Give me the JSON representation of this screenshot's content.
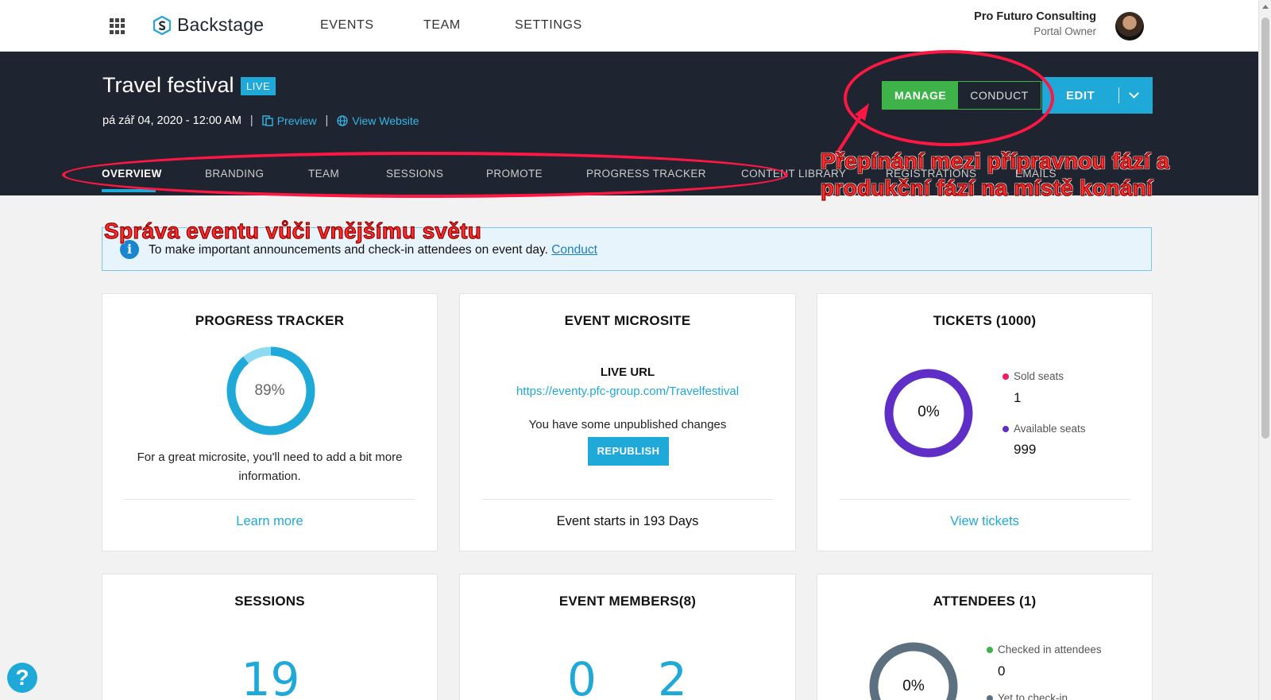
{
  "app": {
    "name": "Backstage"
  },
  "topnav": {
    "events": "EVENTS",
    "team": "TEAM",
    "settings": "SETTINGS"
  },
  "user": {
    "name": "Pro Futuro Consulting",
    "role": "Portal Owner"
  },
  "event": {
    "title": "Travel festival",
    "badge": "LIVE",
    "datetime": "pá zář 04, 2020 - 12:00 AM",
    "preview": "Preview",
    "view_website": "View Website"
  },
  "actions": {
    "manage": "MANAGE",
    "conduct": "CONDUCT",
    "edit": "EDIT"
  },
  "tabs": [
    "OVERVIEW",
    "BRANDING",
    "TEAM",
    "SESSIONS",
    "PROMOTE",
    "PROGRESS TRACKER",
    "CONTENT LIBRARY",
    "REGISTRATIONS",
    "EMAILS"
  ],
  "annotations": {
    "mode_switch": [
      "Přepínání mezi přípravnou fází a",
      "produkční fází na místě konání"
    ],
    "management": "Správa eventu vůči vnějšímu světu",
    "color": "#ff1744"
  },
  "banner": {
    "text": "To make important announcements and check-in attendees on event day.",
    "link": "Conduct"
  },
  "cards": {
    "progress": {
      "title": "PROGRESS TRACKER",
      "percent_label": "89%",
      "percent": 89,
      "text": "For a great microsite, you'll need to add a bit more information.",
      "link": "Learn more"
    },
    "microsite": {
      "title": "EVENT MICROSITE",
      "url_label": "LIVE URL",
      "url": "https://eventy.pfc-group.com/Travelfestival",
      "changes_text": "You have some unpublished changes",
      "republish": "REPUBLISH",
      "footer": "Event starts in 193 Days"
    },
    "tickets": {
      "title": "TICKETS (1000)",
      "percent_label": "0%",
      "sold_label": "Sold seats",
      "sold_value": "1",
      "available_label": "Available seats",
      "available_value": "999",
      "link": "View tickets",
      "sold_color": "#e91e63",
      "available_color": "#5e2ec7"
    },
    "sessions": {
      "title": "SESSIONS",
      "value": "19"
    },
    "members": {
      "title": "EVENT MEMBERS(8)",
      "value_a": "0",
      "value_b": "2"
    },
    "attendees": {
      "title": "ATTENDEES (1)",
      "percent_label": "0%",
      "checked_label": "Checked in attendees",
      "checked_value": "0",
      "yet_label": "Yet to check-in",
      "checked_color": "#3db34a"
    }
  },
  "help": {
    "label": "?"
  },
  "colors": {
    "accent": "#1fa9d8",
    "header_bg": "#1f2530",
    "manage_green": "#3db34a"
  }
}
